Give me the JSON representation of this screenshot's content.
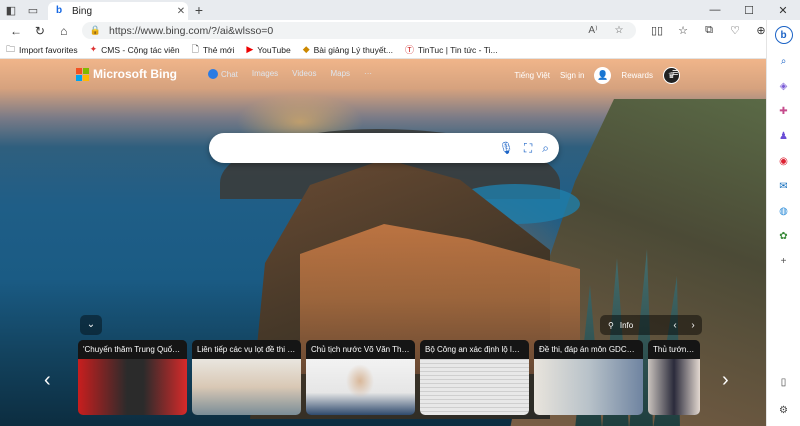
{
  "browser": {
    "tab": {
      "favicon": "bing-logo-icon",
      "title": "Bing"
    },
    "url": "https://www.bing.com/?/ai&wlsso=0",
    "favorites": [
      {
        "label": "Import favorites",
        "icon": "folder-icon"
      },
      {
        "label": "CMS - Cộng tác viên",
        "icon": "cms-site-icon"
      },
      {
        "label": "Thẻ mới",
        "icon": "page-icon"
      },
      {
        "label": "YouTube",
        "icon": "youtube-icon"
      },
      {
        "label": "Bài giảng Lý thuyết...",
        "icon": "site-icon"
      },
      {
        "label": "TinTuc | Tin tức - Ti...",
        "icon": "tintuc-icon"
      }
    ]
  },
  "bing": {
    "logo": "Microsoft Bing",
    "nav": [
      "Chat",
      "Images",
      "Videos",
      "Maps",
      "···"
    ],
    "language": "Tiếng Việt",
    "signin": "Sign in",
    "rewards": "Rewards",
    "search_placeholder": ""
  },
  "image_info": {
    "label": "Info"
  },
  "news": [
    {
      "title": "'Chuyến thăm Trung Quốc ..."
    },
    {
      "title": "Liên tiếp các vụ lọt đề thi t..."
    },
    {
      "title": "Chủ tịch nước Võ Văn Thưở..."
    },
    {
      "title": "Bộ Công an xác định lộ lọt ..."
    },
    {
      "title": "Đề thi, đáp án môn GDCD ..."
    },
    {
      "title": "Thủ tướng tiếp..."
    }
  ],
  "colors": {
    "accent": "#1b63c6",
    "chat": "#2a7be4"
  }
}
